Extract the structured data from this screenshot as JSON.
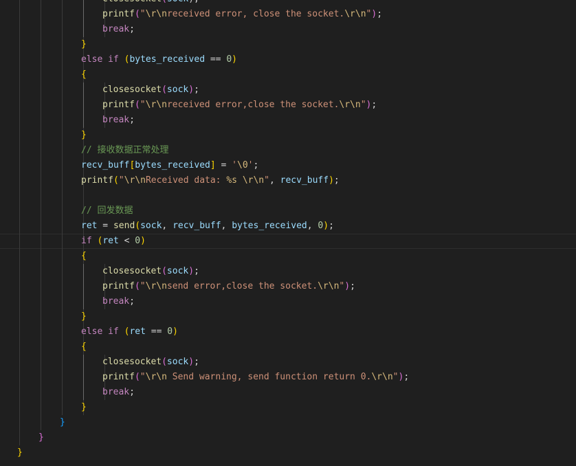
{
  "editor": {
    "colors": {
      "background": "#1f1f1f",
      "keyword": "#c586c0",
      "function": "#dcdcaa",
      "variable": "#9cdcfe",
      "string": "#ce9178",
      "escape": "#d7ba7d",
      "number": "#b5cea8",
      "comment": "#6a9955",
      "plain": "#d4d4d4",
      "bracket_gold": "#ffd700",
      "bracket_purple": "#da70d6",
      "bracket_blue": "#179fff"
    },
    "lines": [
      {
        "indent": 4,
        "guides": 5,
        "tokens": [
          [
            "closesocket",
            "function"
          ],
          [
            "(",
            "bracket_purple"
          ],
          [
            "sock",
            "variable"
          ],
          [
            ");",
            "plain"
          ]
        ]
      },
      {
        "indent": 4,
        "guides": 5,
        "tokens": [
          [
            "printf",
            "function"
          ],
          [
            "(",
            "bracket_purple"
          ],
          [
            "\"",
            "string"
          ],
          [
            "\\r\\n",
            "escape"
          ],
          [
            "received error, close the socket.",
            "string"
          ],
          [
            "\\r\\n",
            "escape"
          ],
          [
            "\"",
            "string"
          ],
          [
            ")",
            "bracket_purple"
          ],
          [
            ";",
            "plain"
          ]
        ]
      },
      {
        "indent": 4,
        "guides": 5,
        "tokens": [
          [
            "break",
            "keyword"
          ],
          [
            ";",
            "plain"
          ]
        ]
      },
      {
        "indent": 3,
        "guides": 4,
        "tokens": [
          [
            "}",
            "bracket_gold"
          ]
        ]
      },
      {
        "indent": 3,
        "guides": 4,
        "tokens": [
          [
            "else if ",
            "keyword"
          ],
          [
            "(",
            "bracket_gold"
          ],
          [
            "bytes_received",
            "variable"
          ],
          [
            " == ",
            "plain"
          ],
          [
            "0",
            "number"
          ],
          [
            ")",
            "bracket_gold"
          ]
        ]
      },
      {
        "indent": 3,
        "guides": 4,
        "tokens": [
          [
            "{",
            "bracket_gold"
          ]
        ]
      },
      {
        "indent": 4,
        "guides": 5,
        "tokens": [
          [
            "closesocket",
            "function"
          ],
          [
            "(",
            "bracket_purple"
          ],
          [
            "sock",
            "variable"
          ],
          [
            ")",
            "bracket_purple"
          ],
          [
            ";",
            "plain"
          ]
        ]
      },
      {
        "indent": 4,
        "guides": 5,
        "tokens": [
          [
            "printf",
            "function"
          ],
          [
            "(",
            "bracket_purple"
          ],
          [
            "\"",
            "string"
          ],
          [
            "\\r\\n",
            "escape"
          ],
          [
            "received error,close the socket.",
            "string"
          ],
          [
            "\\r\\n",
            "escape"
          ],
          [
            "\"",
            "string"
          ],
          [
            ")",
            "bracket_purple"
          ],
          [
            ";",
            "plain"
          ]
        ]
      },
      {
        "indent": 4,
        "guides": 5,
        "tokens": [
          [
            "break",
            "keyword"
          ],
          [
            ";",
            "plain"
          ]
        ]
      },
      {
        "indent": 3,
        "guides": 4,
        "tokens": [
          [
            "}",
            "bracket_gold"
          ]
        ]
      },
      {
        "indent": 3,
        "guides": 4,
        "tokens": [
          [
            "// 接收数据正常处理",
            "comment"
          ]
        ]
      },
      {
        "indent": 3,
        "guides": 4,
        "tokens": [
          [
            "recv_buff",
            "variable"
          ],
          [
            "[",
            "bracket_gold"
          ],
          [
            "bytes_received",
            "variable"
          ],
          [
            "]",
            "bracket_gold"
          ],
          [
            " = ",
            "plain"
          ],
          [
            "'",
            "string"
          ],
          [
            "\\0",
            "escape"
          ],
          [
            "'",
            "string"
          ],
          [
            ";",
            "plain"
          ]
        ]
      },
      {
        "indent": 3,
        "guides": 4,
        "tokens": [
          [
            "printf",
            "function"
          ],
          [
            "(",
            "bracket_gold"
          ],
          [
            "\"",
            "string"
          ],
          [
            "\\r\\n",
            "escape"
          ],
          [
            "Received data: ",
            "string"
          ],
          [
            "%s",
            "escape"
          ],
          [
            " ",
            "string"
          ],
          [
            "\\r\\n",
            "escape"
          ],
          [
            "\"",
            "string"
          ],
          [
            ", ",
            "plain"
          ],
          [
            "recv_buff",
            "variable"
          ],
          [
            ")",
            "bracket_gold"
          ],
          [
            ";",
            "plain"
          ]
        ]
      },
      {
        "indent": 3,
        "guides": 4,
        "tokens": []
      },
      {
        "indent": 3,
        "guides": 4,
        "tokens": [
          [
            "// 回发数据",
            "comment"
          ]
        ]
      },
      {
        "indent": 3,
        "guides": 4,
        "tokens": [
          [
            "ret",
            "variable"
          ],
          [
            " = ",
            "plain"
          ],
          [
            "send",
            "function"
          ],
          [
            "(",
            "bracket_gold"
          ],
          [
            "sock",
            "variable"
          ],
          [
            ", ",
            "plain"
          ],
          [
            "recv_buff",
            "variable"
          ],
          [
            ", ",
            "plain"
          ],
          [
            "bytes_received",
            "variable"
          ],
          [
            ", ",
            "plain"
          ],
          [
            "0",
            "number"
          ],
          [
            ")",
            "bracket_gold"
          ],
          [
            ";",
            "plain"
          ]
        ]
      },
      {
        "indent": 3,
        "guides": 4,
        "current": true,
        "tokens": [
          [
            "if ",
            "keyword"
          ],
          [
            "(",
            "bracket_gold"
          ],
          [
            "ret",
            "variable"
          ],
          [
            " < ",
            "plain"
          ],
          [
            "0",
            "number"
          ],
          [
            ")",
            "bracket_gold"
          ]
        ]
      },
      {
        "indent": 3,
        "guides": 4,
        "tokens": [
          [
            "{",
            "bracket_gold"
          ]
        ]
      },
      {
        "indent": 4,
        "guides": 5,
        "tokens": [
          [
            "closesocket",
            "function"
          ],
          [
            "(",
            "bracket_purple"
          ],
          [
            "sock",
            "variable"
          ],
          [
            ")",
            "bracket_purple"
          ],
          [
            ";",
            "plain"
          ]
        ]
      },
      {
        "indent": 4,
        "guides": 5,
        "tokens": [
          [
            "printf",
            "function"
          ],
          [
            "(",
            "bracket_purple"
          ],
          [
            "\"",
            "string"
          ],
          [
            "\\r\\n",
            "escape"
          ],
          [
            "send error,close the socket.",
            "string"
          ],
          [
            "\\r\\n",
            "escape"
          ],
          [
            "\"",
            "string"
          ],
          [
            ")",
            "bracket_purple"
          ],
          [
            ";",
            "plain"
          ]
        ]
      },
      {
        "indent": 4,
        "guides": 5,
        "tokens": [
          [
            "break",
            "keyword"
          ],
          [
            ";",
            "plain"
          ]
        ]
      },
      {
        "indent": 3,
        "guides": 4,
        "tokens": [
          [
            "}",
            "bracket_gold"
          ]
        ]
      },
      {
        "indent": 3,
        "guides": 4,
        "tokens": [
          [
            "else if ",
            "keyword"
          ],
          [
            "(",
            "bracket_gold"
          ],
          [
            "ret",
            "variable"
          ],
          [
            " == ",
            "plain"
          ],
          [
            "0",
            "number"
          ],
          [
            ")",
            "bracket_gold"
          ]
        ]
      },
      {
        "indent": 3,
        "guides": 4,
        "tokens": [
          [
            "{",
            "bracket_gold"
          ]
        ]
      },
      {
        "indent": 4,
        "guides": 5,
        "tokens": [
          [
            "closesocket",
            "function"
          ],
          [
            "(",
            "bracket_purple"
          ],
          [
            "sock",
            "variable"
          ],
          [
            ")",
            "bracket_purple"
          ],
          [
            ";",
            "plain"
          ]
        ]
      },
      {
        "indent": 4,
        "guides": 5,
        "tokens": [
          [
            "printf",
            "function"
          ],
          [
            "(",
            "bracket_purple"
          ],
          [
            "\"",
            "string"
          ],
          [
            "\\r\\n",
            "escape"
          ],
          [
            " Send warning, send function return 0.",
            "string"
          ],
          [
            "\\r\\n",
            "escape"
          ],
          [
            "\"",
            "string"
          ],
          [
            ")",
            "bracket_purple"
          ],
          [
            ";",
            "plain"
          ]
        ]
      },
      {
        "indent": 4,
        "guides": 5,
        "tokens": [
          [
            "break",
            "keyword"
          ],
          [
            ";",
            "plain"
          ]
        ]
      },
      {
        "indent": 3,
        "guides": 4,
        "tokens": [
          [
            "}",
            "bracket_gold"
          ]
        ]
      },
      {
        "indent": 2,
        "guides": 2,
        "tokens": [
          [
            "}",
            "bracket_blue"
          ]
        ]
      },
      {
        "indent": 1,
        "guides": 1,
        "tokens": [
          [
            "}",
            "bracket_purple"
          ]
        ]
      },
      {
        "indent": 0,
        "guides": 0,
        "tokens": [
          [
            "}",
            "bracket_gold"
          ]
        ]
      }
    ]
  }
}
